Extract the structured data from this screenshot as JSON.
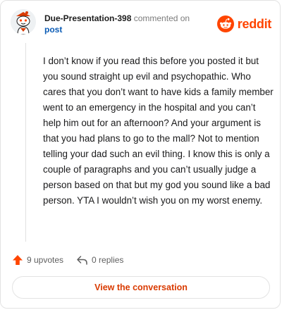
{
  "comment": {
    "username": "Due-Presentation-398",
    "action": "commented on",
    "post_link": "post",
    "brand": "reddit",
    "body": "I don’t know if you read this before you posted it but you sound straight up evil and psychopathic. Who cares that you don’t want to have kids a family member went to an emergency in the hospital and you can’t help him out for an afternoon? And your argument is that you had plans to go to the mall? Not to mention telling your dad such an evil thing. I know this is only a couple of paragraphs and you can’t usually judge a person based on that but my god you sound like a bad person. YTA I wouldn’t wish you on my worst enemy.",
    "upvotes": "9 upvotes",
    "replies": "0 replies",
    "view_conversation": "View the conversation"
  },
  "icons": {
    "avatar": "snoo-avatar",
    "brand": "reddit-logo-icon",
    "upvote": "upvote-arrow-icon",
    "reply": "reply-arrow-icon"
  },
  "colors": {
    "brand_orange": "#ff4500",
    "upvote_orange": "#ff4500",
    "link_blue": "#0a5bb5",
    "cta_text": "#d93a00"
  }
}
